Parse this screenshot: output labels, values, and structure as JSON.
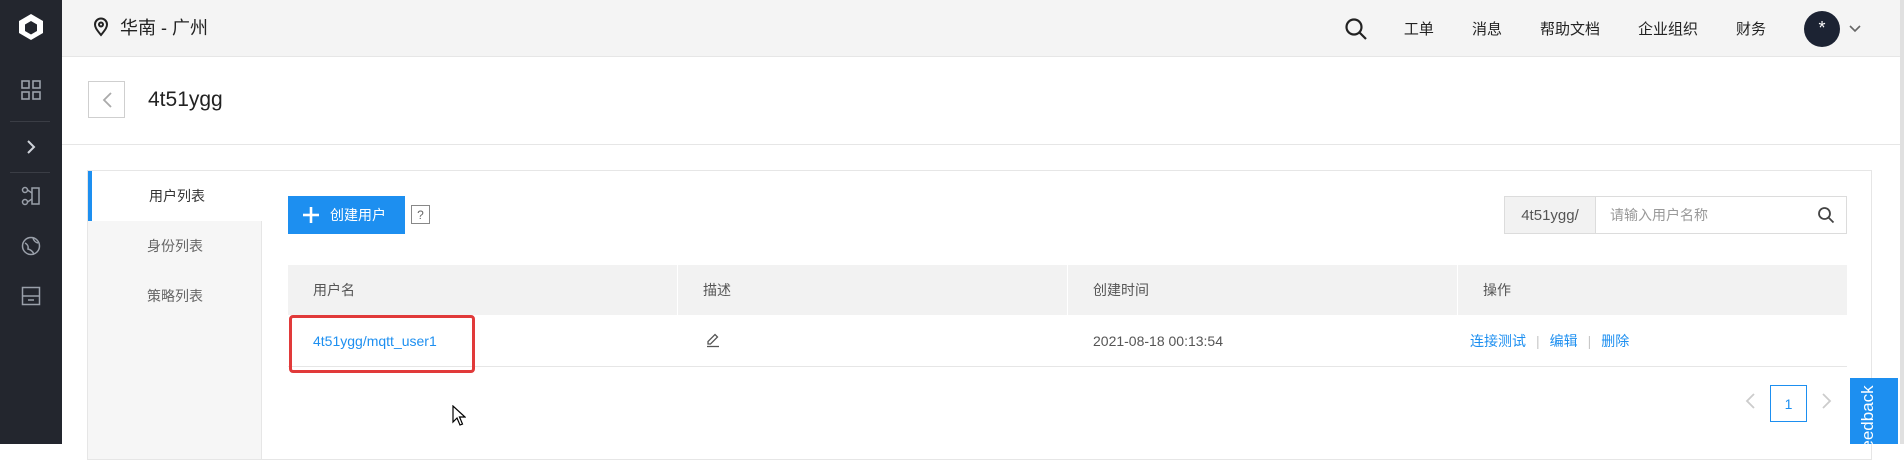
{
  "header": {
    "region": "华南 - 广州",
    "nav": [
      "工单",
      "消息",
      "帮助文档",
      "企业组织",
      "财务"
    ],
    "avatar_text": "*"
  },
  "rail": {
    "icons": [
      "logo-icon",
      "dashboard-grid-icon",
      "expand-chevron-icon",
      "nodes-icon",
      "globe-icon",
      "inbox-icon"
    ]
  },
  "title": {
    "text": "4t51ygg",
    "back_glyph": "<"
  },
  "side_tabs": [
    {
      "label": "用户列表",
      "active": true
    },
    {
      "label": "身份列表",
      "active": false
    },
    {
      "label": "策略列表",
      "active": false
    }
  ],
  "toolbar": {
    "create_label": "创建用户",
    "help_glyph": "?"
  },
  "search": {
    "prefix": "4t51ygg/",
    "placeholder": "请输入用户名称"
  },
  "table": {
    "columns": [
      "用户名",
      "描述",
      "创建时间",
      "操作"
    ],
    "rows": [
      {
        "username": "4t51ygg/mqtt_user1",
        "created": "2021-08-18 00:13:54",
        "actions": [
          "连接测试",
          "编辑",
          "删除"
        ]
      }
    ]
  },
  "pager": {
    "current": "1"
  },
  "feedback": {
    "label": "Feedback"
  },
  "colors": {
    "accent": "#1d8ff0",
    "rail": "#23262e",
    "highlight": "#e13a3a"
  }
}
